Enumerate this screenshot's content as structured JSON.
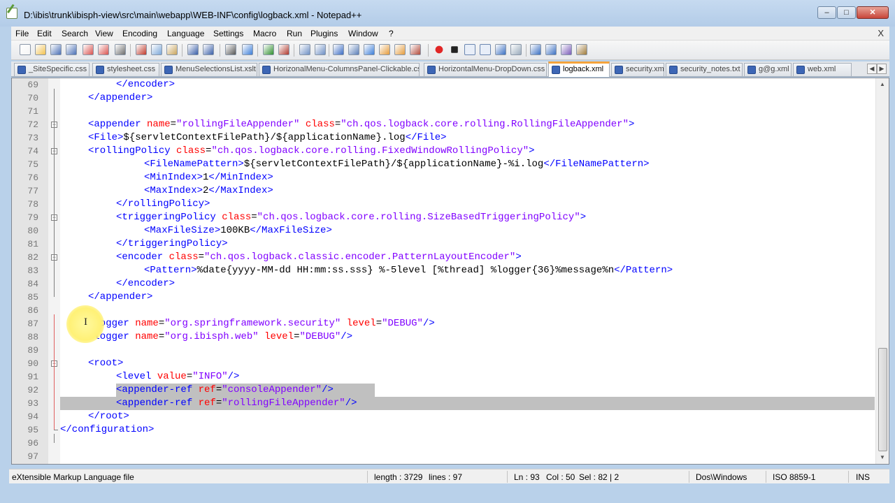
{
  "window": {
    "title": "D:\\ibis\\trunk\\ibisph-view\\src\\main\\webapp\\WEB-INF\\config\\logback.xml - Notepad++"
  },
  "menu": [
    "File",
    "Edit",
    "Search",
    "View",
    "Encoding",
    "Language",
    "Settings",
    "Macro",
    "Run",
    "Plugins",
    "Window",
    "?"
  ],
  "menu_close": "X",
  "tabs": [
    "_SiteSpecific.css",
    "stylesheet.css",
    "MenuSelectionsList.xslt",
    "HorizonalMenu-ColumnsPanel-Clickable.css",
    "HorizontalMenu-DropDown.css",
    "logback.xml",
    "security.xml",
    "security_notes.txt",
    "g@g.xml",
    "web.xml"
  ],
  "active_tab": "logback.xml",
  "editor": {
    "current_line": 93,
    "lines": [
      {
        "n": "69",
        "indent": 8,
        "segs": [
          [
            "t",
            "</encoder>"
          ]
        ]
      },
      {
        "n": "70",
        "indent": 4,
        "segs": [
          [
            "t",
            "</appender>"
          ]
        ]
      },
      {
        "n": "71",
        "indent": 0,
        "segs": []
      },
      {
        "n": "72",
        "indent": 4,
        "segs": [
          [
            "t",
            "<appender "
          ],
          [
            "a",
            "name"
          ],
          [
            "x",
            "="
          ],
          [
            "v",
            "\"rollingFileAppender\""
          ],
          [
            "t",
            " "
          ],
          [
            "a",
            "class"
          ],
          [
            "x",
            "="
          ],
          [
            "v",
            "\"ch.qos.logback.core.rolling.RollingFileAppender\""
          ],
          [
            "t",
            ">"
          ]
        ]
      },
      {
        "n": "73",
        "indent": 4,
        "segs": [
          [
            "t",
            "<File>"
          ],
          [
            "x",
            "${servletContextFilePath}/${applicationName}.log"
          ],
          [
            "t",
            "</File>"
          ]
        ]
      },
      {
        "n": "74",
        "indent": 4,
        "segs": [
          [
            "t",
            "<rollingPolicy "
          ],
          [
            "a",
            "class"
          ],
          [
            "x",
            "="
          ],
          [
            "v",
            "\"ch.qos.logback.core.rolling.FixedWindowRollingPolicy\""
          ],
          [
            "t",
            ">"
          ]
        ]
      },
      {
        "n": "75",
        "indent": 12,
        "segs": [
          [
            "t",
            "<FileNamePattern>"
          ],
          [
            "x",
            "${servletContextFilePath}/${applicationName}-%i.log"
          ],
          [
            "t",
            "</FileNamePattern>"
          ]
        ]
      },
      {
        "n": "76",
        "indent": 12,
        "segs": [
          [
            "t",
            "<MinIndex>"
          ],
          [
            "x",
            "1"
          ],
          [
            "t",
            "</MinIndex>"
          ]
        ]
      },
      {
        "n": "77",
        "indent": 12,
        "segs": [
          [
            "t",
            "<MaxIndex>"
          ],
          [
            "x",
            "2"
          ],
          [
            "t",
            "</MaxIndex>"
          ]
        ]
      },
      {
        "n": "78",
        "indent": 8,
        "segs": [
          [
            "t",
            "</rollingPolicy>"
          ]
        ]
      },
      {
        "n": "79",
        "indent": 8,
        "segs": [
          [
            "t",
            "<triggeringPolicy "
          ],
          [
            "a",
            "class"
          ],
          [
            "x",
            "="
          ],
          [
            "v",
            "\"ch.qos.logback.core.rolling.SizeBasedTriggeringPolicy\""
          ],
          [
            "t",
            ">"
          ]
        ]
      },
      {
        "n": "80",
        "indent": 12,
        "segs": [
          [
            "t",
            "<MaxFileSize>"
          ],
          [
            "x",
            "100KB"
          ],
          [
            "t",
            "</MaxFileSize>"
          ]
        ]
      },
      {
        "n": "81",
        "indent": 8,
        "segs": [
          [
            "t",
            "</triggeringPolicy>"
          ]
        ]
      },
      {
        "n": "82",
        "indent": 8,
        "segs": [
          [
            "t",
            "<encoder "
          ],
          [
            "a",
            "class"
          ],
          [
            "x",
            "="
          ],
          [
            "v",
            "\"ch.qos.logback.classic.encoder.PatternLayoutEncoder\""
          ],
          [
            "t",
            ">"
          ]
        ]
      },
      {
        "n": "83",
        "indent": 12,
        "segs": [
          [
            "t",
            "<Pattern>"
          ],
          [
            "x",
            "%date{yyyy-MM-dd HH:mm:ss.sss} %-5level [%thread] %logger{36}%message%n"
          ],
          [
            "t",
            "</Pattern>"
          ]
        ]
      },
      {
        "n": "84",
        "indent": 8,
        "segs": [
          [
            "t",
            "</encoder>"
          ]
        ]
      },
      {
        "n": "85",
        "indent": 4,
        "segs": [
          [
            "t",
            "</appender>"
          ]
        ]
      },
      {
        "n": "86",
        "indent": 0,
        "segs": []
      },
      {
        "n": "87",
        "indent": 4,
        "segs": [
          [
            "t",
            "<logger "
          ],
          [
            "a",
            "name"
          ],
          [
            "x",
            "="
          ],
          [
            "v",
            "\"org.springframework.security\""
          ],
          [
            "t",
            " "
          ],
          [
            "a",
            "level"
          ],
          [
            "x",
            "="
          ],
          [
            "v",
            "\"DEBUG\""
          ],
          [
            "t",
            "/>"
          ]
        ]
      },
      {
        "n": "88",
        "indent": 4,
        "segs": [
          [
            "t",
            "<logger "
          ],
          [
            "a",
            "name"
          ],
          [
            "x",
            "="
          ],
          [
            "v",
            "\"org.ibisph.web\""
          ],
          [
            "t",
            " "
          ],
          [
            "a",
            "level"
          ],
          [
            "x",
            "="
          ],
          [
            "v",
            "\"DEBUG\""
          ],
          [
            "t",
            "/>"
          ]
        ]
      },
      {
        "n": "89",
        "indent": 0,
        "segs": []
      },
      {
        "n": "90",
        "indent": 4,
        "segs": [
          [
            "t",
            "<root>"
          ]
        ]
      },
      {
        "n": "91",
        "indent": 8,
        "segs": [
          [
            "t",
            "<level "
          ],
          [
            "a",
            "value"
          ],
          [
            "x",
            "="
          ],
          [
            "v",
            "\"INFO\""
          ],
          [
            "t",
            "/>"
          ]
        ]
      },
      {
        "n": "92",
        "indent": 8,
        "segs": [
          [
            "t",
            "<appender-ref "
          ],
          [
            "a",
            "ref"
          ],
          [
            "x",
            "="
          ],
          [
            "v",
            "\"consoleAppender\""
          ],
          [
            "t",
            "/>"
          ]
        ]
      },
      {
        "n": "93",
        "indent": 8,
        "segs": [
          [
            "t",
            "<appender-ref "
          ],
          [
            "a",
            "ref"
          ],
          [
            "x",
            "="
          ],
          [
            "v",
            "\"rollingFileAppender\""
          ],
          [
            "t",
            "/>"
          ]
        ]
      },
      {
        "n": "94",
        "indent": 4,
        "segs": [
          [
            "t",
            "</root>"
          ]
        ]
      },
      {
        "n": "95",
        "indent": 0,
        "segs": [
          [
            "t",
            "</configuration>"
          ]
        ]
      },
      {
        "n": "96",
        "indent": 0,
        "segs": []
      },
      {
        "n": "97",
        "indent": 0,
        "segs": []
      }
    ]
  },
  "status": {
    "filetype": "eXtensible Markup Language file",
    "length": "length : 3729",
    "lines": "lines : 97",
    "ln": "Ln : 93",
    "col": "Col : 50",
    "sel": "Sel : 82 | 2",
    "eol": "Dos\\Windows",
    "encoding": "ISO 8859-1",
    "mode": "INS"
  },
  "icons": [
    "new-file-icon",
    "open-icon",
    "save-icon",
    "save-all-icon",
    "close-icon",
    "close-all-icon",
    "print-icon",
    "cut-icon",
    "copy-icon",
    "paste-icon",
    "undo-icon",
    "redo-icon",
    "find-icon",
    "replace-icon",
    "zoom-in-icon",
    "zoom-out-icon",
    "sync-v-icon",
    "sync-h-icon",
    "wrap-icon",
    "all-chars-icon",
    "indent-guide-icon",
    "fold-icon",
    "unfold-icon",
    "doc-map-icon",
    "record-icon",
    "stop-icon",
    "play-icon",
    "play-multi-icon",
    "save-macro-icon",
    "trim-icon",
    "up-icon",
    "down-icon",
    "spellcheck-icon",
    "clipboard-icon"
  ]
}
